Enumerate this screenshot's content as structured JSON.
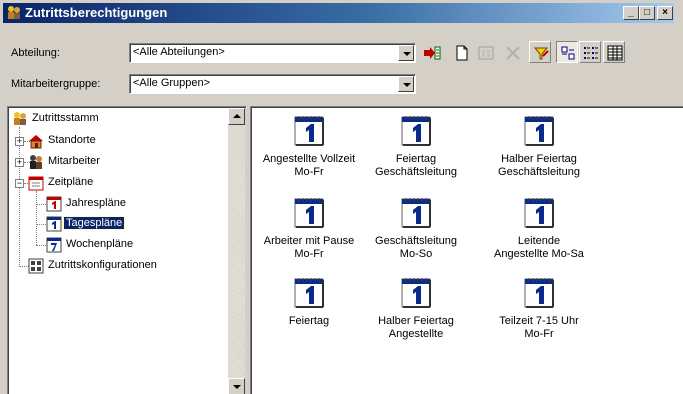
{
  "window": {
    "title": "Zutrittsberechtigungen",
    "buttons": {
      "minimize": "_",
      "maximize": "□",
      "close": "×"
    }
  },
  "filters": {
    "abteilung": {
      "label": "Abteilung:",
      "value": "<Alle Abteilungen>"
    },
    "mitarbeitergruppe": {
      "label": "Mitarbeitergruppe:",
      "value": "<Alle Gruppen>"
    }
  },
  "toolbar": {
    "items": [
      {
        "name": "transfer-icon",
        "state": "normal"
      },
      {
        "name": "new-document-icon",
        "state": "normal"
      },
      {
        "name": "properties-icon",
        "state": "disabled"
      },
      {
        "name": "delete-icon",
        "state": "disabled"
      },
      {
        "name": "filter-icon",
        "state": "raised"
      },
      {
        "name": "large-icons-view-icon",
        "state": "pressed"
      },
      {
        "name": "list-view-icon",
        "state": "raised"
      },
      {
        "name": "details-view-icon",
        "state": "raised"
      }
    ]
  },
  "tree": {
    "root": "Zutrittsstamm",
    "standorte": "Standorte",
    "mitarbeiter": "Mitarbeiter",
    "zeitplaene": "Zeitpläne",
    "jahresplaene": "Jahrespläne",
    "tagesplaene": "Tagespläne",
    "wochenplaene": "Wochenpläne",
    "zutrittskonfigurationen": "Zutrittskonfigurationen"
  },
  "items": [
    {
      "line1": "Angestellte Vollzeit",
      "line2": "Mo-Fr"
    },
    {
      "line1": "Feiertag",
      "line2": "Geschäftsleitung"
    },
    {
      "line1": "Halber Feiertag",
      "line2": "Geschäftsleitung"
    },
    {
      "line1": "Arbeiter mit Pause",
      "line2": "Mo-Fr"
    },
    {
      "line1": "Geschäftsleitung",
      "line2": "Mo-So"
    },
    {
      "line1": "Leitende",
      "line2": "Angestellte Mo-Sa"
    },
    {
      "line1": "Feiertag",
      "line2": ""
    },
    {
      "line1": "Halber Feiertag",
      "line2": "Angestellte"
    },
    {
      "line1": "Teilzeit 7-15 Uhr",
      "line2": "Mo-Fr"
    }
  ],
  "calendar_icon_glyph": "1",
  "colors": {
    "titlebar_start": "#0a246a",
    "titlebar_end": "#a6caf0",
    "selection": "#0a246a",
    "calendar_blue": "#0a2a8a"
  }
}
